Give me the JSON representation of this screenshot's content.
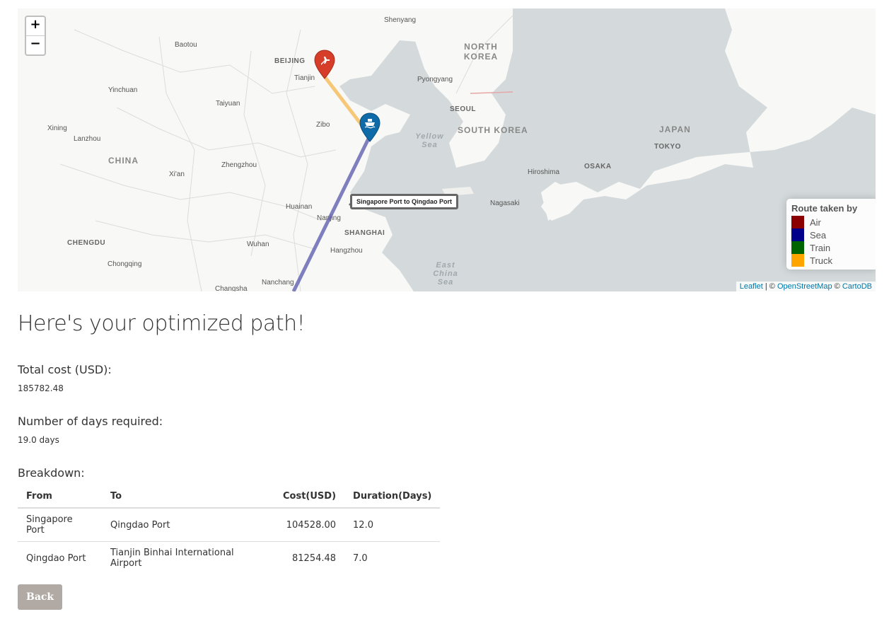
{
  "map": {
    "zoom_in": "+",
    "zoom_out": "−",
    "tooltip": "Singapore Port to Qingdao Port",
    "cities": [
      {
        "name": "Shenyang",
        "cls": "city"
      },
      {
        "name": "Baotou",
        "cls": "city"
      },
      {
        "name": "BEIJING",
        "cls": "city cap"
      },
      {
        "name": "Tianjin",
        "cls": "city"
      },
      {
        "name": "Yinchuan",
        "cls": "city"
      },
      {
        "name": "Pyongyang",
        "cls": "city"
      },
      {
        "name": "Taiyuan",
        "cls": "city"
      },
      {
        "name": "SEOUL",
        "cls": "city cap"
      },
      {
        "name": "Zibo",
        "cls": "city"
      },
      {
        "name": "Xining",
        "cls": "city"
      },
      {
        "name": "Lanzhou",
        "cls": "city"
      },
      {
        "name": "TOKYO",
        "cls": "city cap"
      },
      {
        "name": "Zhengzhou",
        "cls": "city"
      },
      {
        "name": "Xi'an",
        "cls": "city"
      },
      {
        "name": "Hiroshima",
        "cls": "city"
      },
      {
        "name": "OSAKA",
        "cls": "city cap"
      },
      {
        "name": "Huainan",
        "cls": "city"
      },
      {
        "name": "Nagasaki",
        "cls": "city"
      },
      {
        "name": "Nanjing",
        "cls": "city"
      },
      {
        "name": "SHANGHAI",
        "cls": "city cap"
      },
      {
        "name": "CHENGDU",
        "cls": "city cap"
      },
      {
        "name": "Wuhan",
        "cls": "city"
      },
      {
        "name": "Hangzhou",
        "cls": "city"
      },
      {
        "name": "Chongqing",
        "cls": "city"
      },
      {
        "name": "Nanchang",
        "cls": "city"
      },
      {
        "name": "Changsha",
        "cls": "city"
      }
    ],
    "countries": [
      "NORTH KOREA",
      "SOUTH KOREA",
      "JAPAN",
      "CHINA"
    ],
    "seas": [
      "Yellow Sea",
      "East China Sea"
    ],
    "legend": {
      "title": "Route taken by",
      "items": [
        {
          "label": "Air",
          "color": "#8b0000"
        },
        {
          "label": "Sea",
          "color": "#00008b"
        },
        {
          "label": "Train",
          "color": "#006400"
        },
        {
          "label": "Truck",
          "color": "#ffa500"
        }
      ]
    },
    "attribution": {
      "leaflet": "Leaflet",
      "sep1": " | © ",
      "osm": "OpenStreetMap",
      "sep2": " © ",
      "carto": "CartoDB"
    }
  },
  "result": {
    "heading": "Here's your optimized path!",
    "total_cost_label": "Total cost (USD):",
    "total_cost_value": "185782.48",
    "days_label": "Number of days required:",
    "days_value": "19.0 days",
    "breakdown_label": "Breakdown:",
    "columns": [
      "From",
      "To",
      "Cost(USD)",
      "Duration(Days)"
    ],
    "rows": [
      [
        "Singapore Port",
        "Qingdao Port",
        "104528.00",
        "12.0"
      ],
      [
        "Qingdao Port",
        "Tianjin Binhai International Airport",
        "81254.48",
        "7.0"
      ]
    ],
    "back_label": "Back"
  }
}
